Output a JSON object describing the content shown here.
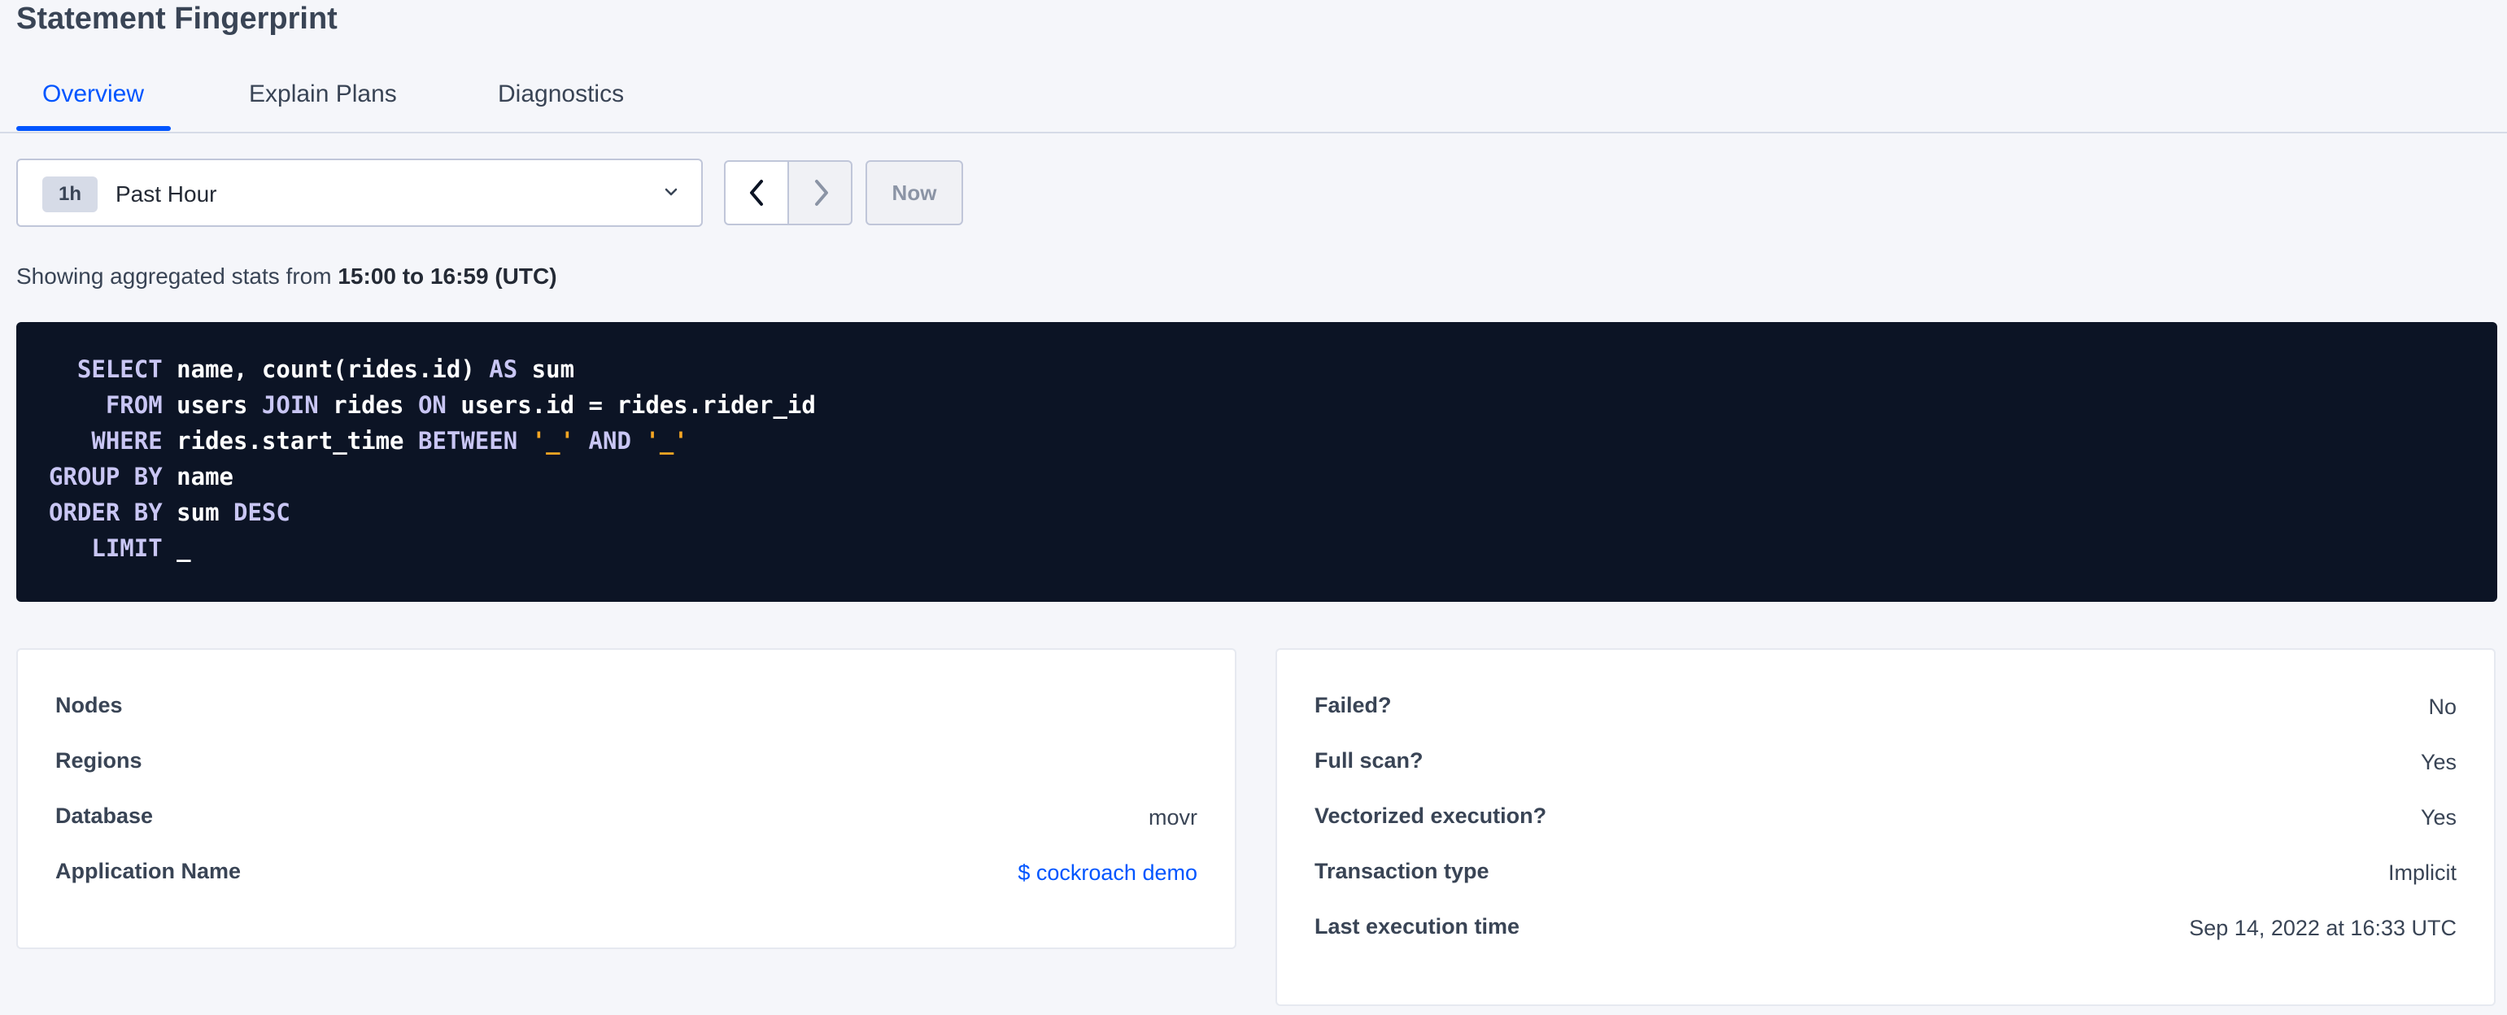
{
  "page": {
    "title": "Statement Fingerprint"
  },
  "tabs": [
    {
      "label": "Overview",
      "active": true
    },
    {
      "label": "Explain Plans",
      "active": false
    },
    {
      "label": "Diagnostics",
      "active": false
    }
  ],
  "time_selector": {
    "badge": "1h",
    "label": "Past Hour",
    "now_label": "Now"
  },
  "aggregation": {
    "prefix": "Showing aggregated stats from ",
    "range": "15:00 to 16:59 (UTC)"
  },
  "sql": {
    "lines": [
      [
        {
          "t": "  ",
          "k": "plain"
        },
        {
          "t": "SELECT",
          "k": "kw"
        },
        {
          "t": " name, count(rides.id) ",
          "k": "plain"
        },
        {
          "t": "AS",
          "k": "kw"
        },
        {
          "t": " sum",
          "k": "plain"
        }
      ],
      [
        {
          "t": "    ",
          "k": "plain"
        },
        {
          "t": "FROM",
          "k": "kw"
        },
        {
          "t": " users ",
          "k": "plain"
        },
        {
          "t": "JOIN",
          "k": "kw"
        },
        {
          "t": " rides ",
          "k": "plain"
        },
        {
          "t": "ON",
          "k": "kw"
        },
        {
          "t": " users.id = rides.rider_id",
          "k": "plain"
        }
      ],
      [
        {
          "t": "   ",
          "k": "plain"
        },
        {
          "t": "WHERE",
          "k": "kw"
        },
        {
          "t": " rides.start_time ",
          "k": "plain"
        },
        {
          "t": "BETWEEN",
          "k": "kw"
        },
        {
          "t": " ",
          "k": "plain"
        },
        {
          "t": "'_'",
          "k": "str"
        },
        {
          "t": " ",
          "k": "plain"
        },
        {
          "t": "AND",
          "k": "kw"
        },
        {
          "t": " ",
          "k": "plain"
        },
        {
          "t": "'_'",
          "k": "str"
        }
      ],
      [
        {
          "t": "GROUP BY",
          "k": "kw"
        },
        {
          "t": " name",
          "k": "plain"
        }
      ],
      [
        {
          "t": "ORDER BY",
          "k": "kw"
        },
        {
          "t": " sum ",
          "k": "plain"
        },
        {
          "t": "DESC",
          "k": "kw"
        }
      ],
      [
        {
          "t": "   ",
          "k": "plain"
        },
        {
          "t": "LIMIT",
          "k": "kw"
        },
        {
          "t": " _",
          "k": "plain"
        }
      ]
    ],
    "colors": {
      "background": "#0c1425",
      "keyword": "#c9c6f4",
      "string": "#f5a623",
      "text": "#ffffff"
    }
  },
  "left_card": {
    "rows": [
      {
        "label": "Nodes",
        "value": "",
        "link": false
      },
      {
        "label": "Regions",
        "value": "",
        "link": false
      },
      {
        "label": "Database",
        "value": "movr",
        "link": false
      },
      {
        "label": "Application Name",
        "value": "$ cockroach demo",
        "link": true
      }
    ]
  },
  "right_card": {
    "rows": [
      {
        "label": "Failed?",
        "value": "No"
      },
      {
        "label": "Full scan?",
        "value": "Yes"
      },
      {
        "label": "Vectorized execution?",
        "value": "Yes"
      },
      {
        "label": "Transaction type",
        "value": "Implicit"
      },
      {
        "label": "Last execution time",
        "value": "Sep 14, 2022 at 16:33 UTC"
      }
    ]
  },
  "colors": {
    "accent": "#0055ff",
    "page_background": "#f5f6fa"
  }
}
